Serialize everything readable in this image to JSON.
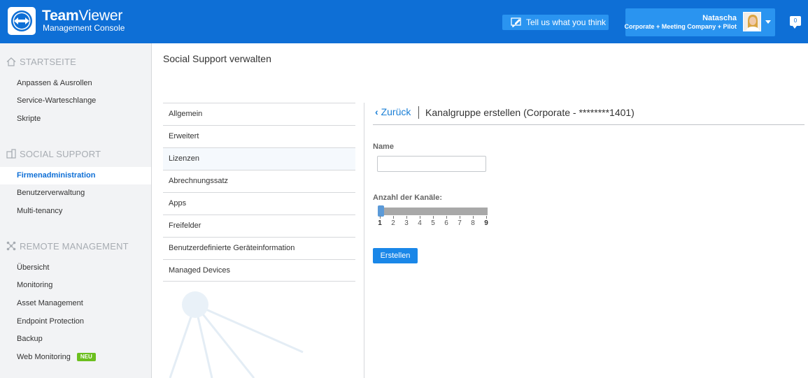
{
  "header": {
    "brand_bold": "Team",
    "brand_light": "Viewer",
    "subtitle": "Management Console",
    "feedback_label": "Tell us what you think",
    "user": {
      "name": "Natascha",
      "org": "Corporate + Meeting Company + Pilot"
    },
    "notification_count": "0",
    "colors": {
      "header_bg": "#0e6fd6",
      "button_bg": "#2a94f0"
    }
  },
  "sidebar": {
    "sections": [
      {
        "title": "STARTSEITE",
        "icon": "home-icon",
        "items": [
          {
            "label": "Anpassen & Ausrollen"
          },
          {
            "label": "Service-Warteschlange"
          },
          {
            "label": "Skripte"
          }
        ]
      },
      {
        "title": "SOCIAL SUPPORT",
        "icon": "building-icon",
        "items": [
          {
            "label": "Firmenadministration",
            "active": true
          },
          {
            "label": "Benutzerverwaltung"
          },
          {
            "label": "Multi-tenancy"
          }
        ]
      },
      {
        "title": "REMOTE MANAGEMENT",
        "icon": "network-icon",
        "items": [
          {
            "label": "Übersicht"
          },
          {
            "label": "Monitoring"
          },
          {
            "label": "Asset Management"
          },
          {
            "label": "Endpoint Protection"
          },
          {
            "label": "Backup"
          },
          {
            "label": "Web Monitoring",
            "badge": "NEU"
          }
        ]
      }
    ]
  },
  "main": {
    "page_title": "Social Support verwalten",
    "sub_nav": [
      {
        "label": "Allgemein"
      },
      {
        "label": "Erweitert"
      },
      {
        "label": "Lizenzen"
      },
      {
        "label": "Abrechnungssatz"
      },
      {
        "label": "Apps"
      },
      {
        "label": "Freifelder"
      },
      {
        "label": "Benutzerdefinierte Geräteinformation"
      },
      {
        "label": "Managed Devices"
      }
    ],
    "form": {
      "back_label": "Zurück",
      "title": "Kanalgruppe erstellen (Corporate - ********1401)",
      "name_label": "Name",
      "name_value": "",
      "channels_label": "Anzahl der Kanäle:",
      "slider": {
        "min": 1,
        "max": 9,
        "value": 1,
        "ticks": [
          "1",
          "2",
          "3",
          "4",
          "5",
          "6",
          "7",
          "8",
          "9"
        ]
      },
      "submit_label": "Erstellen"
    }
  }
}
